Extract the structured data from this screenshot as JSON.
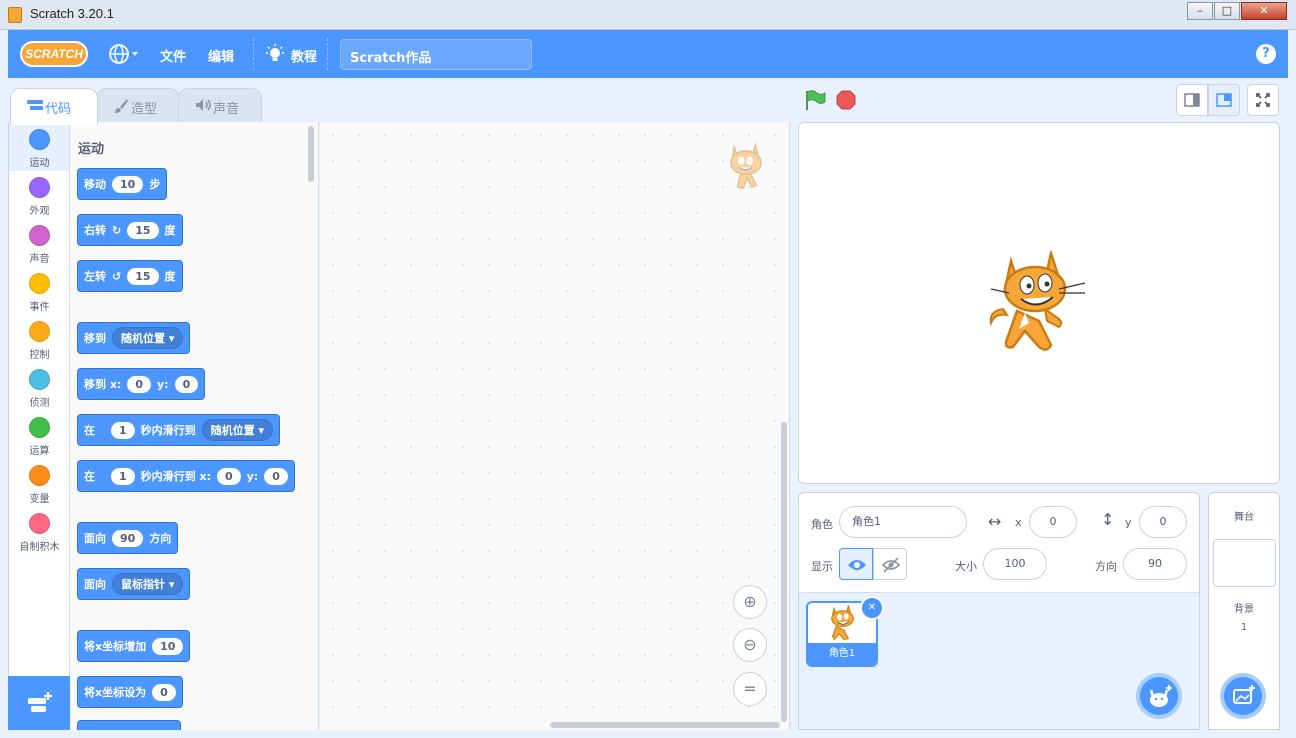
{
  "window": {
    "title": "Scratch 3.20.1",
    "minimize": "0",
    "maximize": "1",
    "close": "r"
  },
  "menubar": {
    "logo": "SCRATCH",
    "language_icon": "globe-icon",
    "file": "文件",
    "edit": "编辑",
    "tutorials": "教程",
    "project_title": "Scratch作品",
    "help": "?"
  },
  "tabs": [
    {
      "label": "代码",
      "icon": "code-icon"
    },
    {
      "label": "造型",
      "icon": "brush-icon"
    },
    {
      "label": "声音",
      "icon": "speaker-icon"
    }
  ],
  "categories": [
    {
      "label": "运动",
      "color": "#4c97ff"
    },
    {
      "label": "外观",
      "color": "#9966ff"
    },
    {
      "label": "声音",
      "color": "#cf63cf"
    },
    {
      "label": "事件",
      "color": "#ffbf00"
    },
    {
      "label": "控制",
      "color": "#ffab19"
    },
    {
      "label": "侦测",
      "color": "#4cbfe6"
    },
    {
      "label": "运算",
      "color": "#40bf4a"
    },
    {
      "label": "变量",
      "color": "#ff8c1a"
    },
    {
      "label": "自制积木",
      "color": "#ff6680"
    }
  ],
  "palette": {
    "heading": "运动",
    "move": {
      "a": "移动",
      "v": "10",
      "b": "步"
    },
    "turn_right": {
      "a": "右转",
      "v": "15",
      "b": "度"
    },
    "turn_left": {
      "a": "左转",
      "v": "15",
      "b": "度"
    },
    "goto": {
      "a": "移到",
      "d": "随机位置"
    },
    "goto_xy": {
      "a": "移到 x:",
      "x": "0",
      "ylabel": "y:",
      "y": "0"
    },
    "glide": {
      "a": "在",
      "v": "1",
      "b": "秒内滑行到",
      "d": "随机位置"
    },
    "glide_xy": {
      "a": "在",
      "v": "1",
      "b": "秒内滑行到 x:",
      "x": "0",
      "ylabel": "y:",
      "y": "0"
    },
    "point_dir": {
      "a": "面向",
      "v": "90",
      "b": "方向"
    },
    "point_towards": {
      "a": "面向",
      "d": "鼠标指针"
    },
    "change_x": {
      "a": "将x坐标增加",
      "v": "10"
    },
    "set_x": {
      "a": "将x坐标设为",
      "v": "0"
    }
  },
  "zoom": {
    "in": "+",
    "out": "−",
    "reset": "="
  },
  "sprite_info": {
    "sprite_label": "角色",
    "sprite_name": "角色1",
    "x_label": "x",
    "x_value": "0",
    "y_label": "y",
    "y_value": "0",
    "show_label": "显示",
    "size_label": "大小",
    "size_value": "100",
    "direction_label": "方向",
    "direction_value": "90"
  },
  "sprite_list": [
    {
      "name": "角色1"
    }
  ],
  "stage_panel": {
    "label": "舞台",
    "backdrop_label": "背景",
    "backdrop_count": "1"
  },
  "colors": {
    "accent": "#4c97ff",
    "menubar": "#4c97ff",
    "motion": "#4c97ff"
  }
}
